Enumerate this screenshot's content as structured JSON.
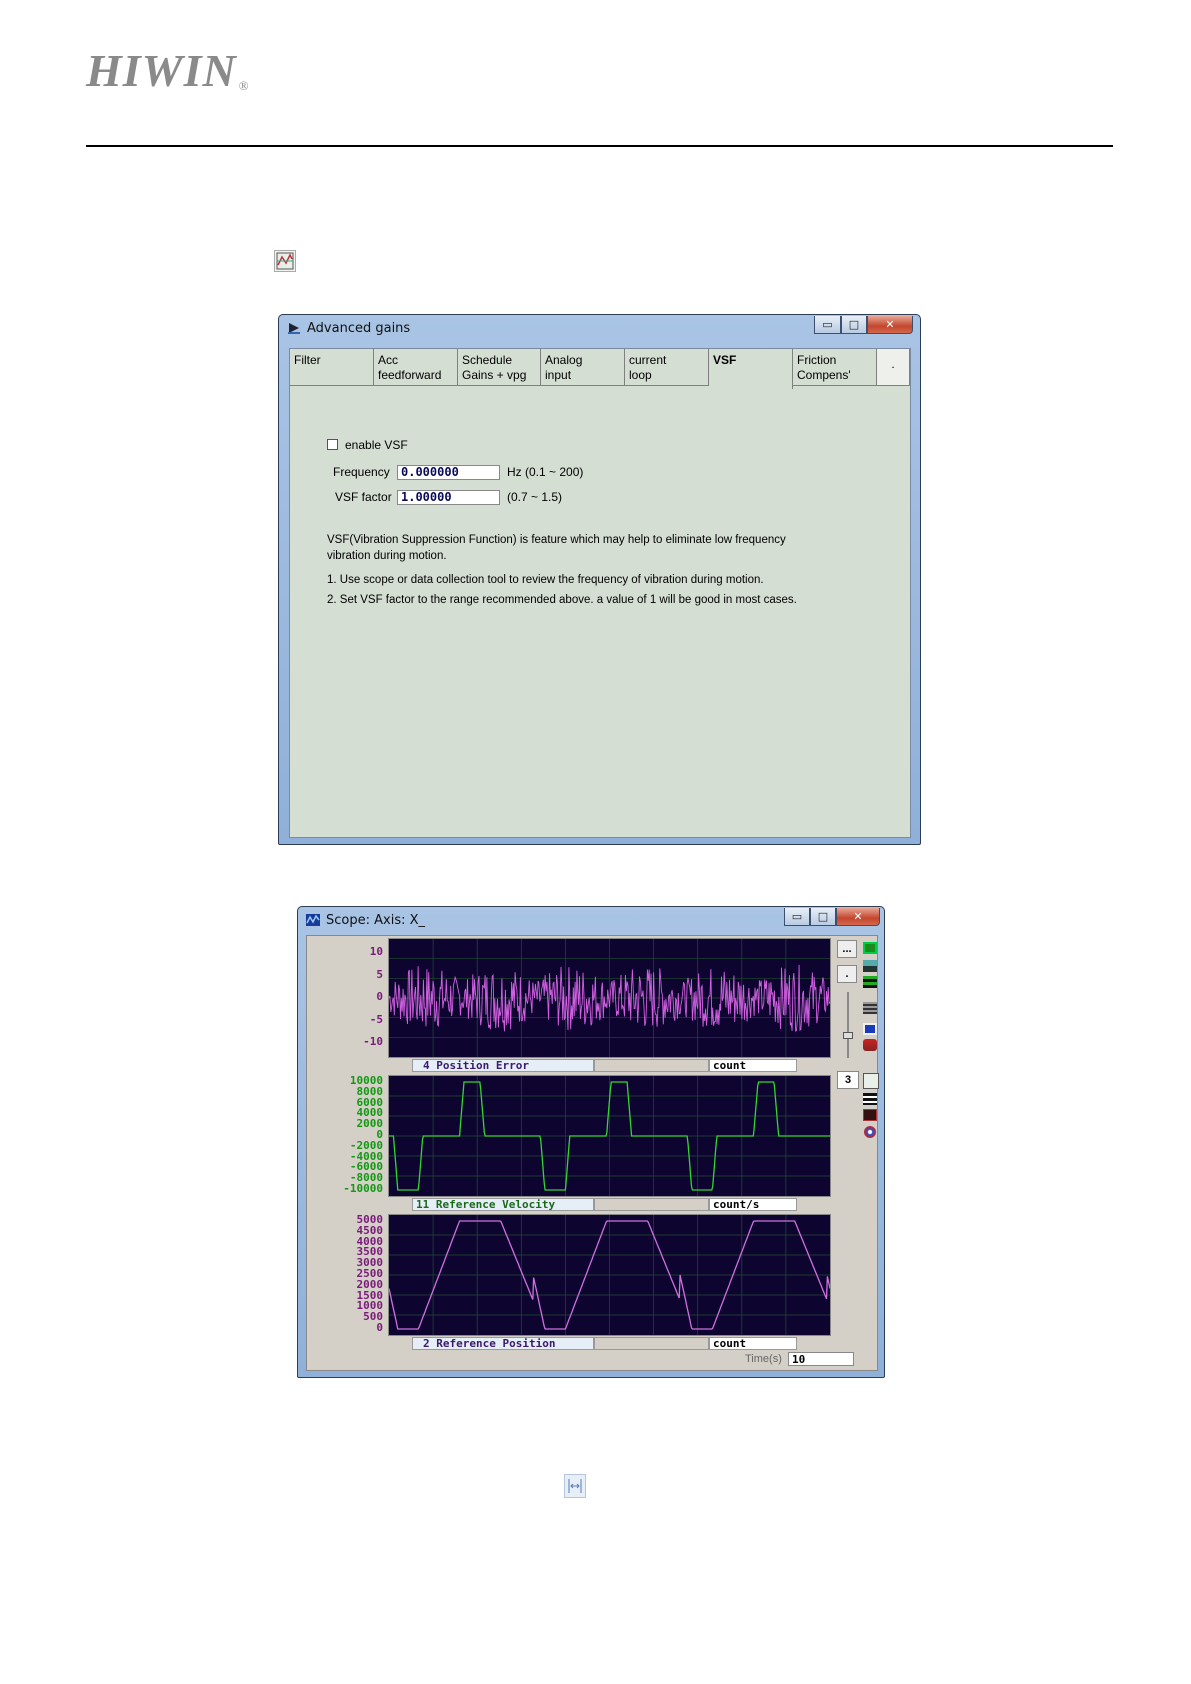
{
  "logo": {
    "name": "HIWIN",
    "mark": "®"
  },
  "advanced_gains": {
    "title": "Advanced gains",
    "caption_buttons": {
      "minimize": "▭",
      "maximize": "□",
      "close": "✕"
    },
    "tabs": [
      {
        "line1": "Filter",
        "line2": ""
      },
      {
        "line1": "Acc",
        "line2": "feedforward"
      },
      {
        "line1": "Schedule",
        "line2": "Gains + vpg"
      },
      {
        "line1": "Analog",
        "line2": "input"
      },
      {
        "line1": "current",
        "line2": "loop"
      },
      {
        "line1": "VSF",
        "line2": ""
      },
      {
        "line1": "Friction",
        "line2": "Compens'"
      }
    ],
    "tab_more": ".",
    "enable_label": "enable VSF",
    "frequency_label": "Frequency",
    "frequency_value": "0.000000",
    "frequency_range": "Hz (0.1 ~ 200)",
    "factor_label": "VSF factor",
    "factor_value": "1.00000",
    "factor_range": "(0.7 ~ 1.5)",
    "desc_line1": "VSF(Vibration Suppression Function) is feature which may help to eliminate low frequency",
    "desc_line2": "vibration during motion.",
    "step1": "1. Use scope or data collection tool to review the frequency of vibration during motion.",
    "step2": "2. Set VSF factor to the range recommended above. a value of 1 will be good in most cases."
  },
  "scope": {
    "title": "Scope: Axis: X_",
    "caption_buttons": {
      "minimize": "▭",
      "maximize": "□",
      "close": "✕"
    },
    "btn_more": "...",
    "btn_dot": ".",
    "channel_count": "3",
    "time_label": "Time(s)",
    "time_value": "10",
    "channels": [
      {
        "name": "4 Position Error",
        "unit": "count",
        "color": "#d060e0",
        "ticks": [
          "10",
          "5",
          "0",
          "-5",
          "-10"
        ],
        "ylim": [
          -12,
          12
        ]
      },
      {
        "name": "11 Reference Velocity",
        "unit": "count/s",
        "color": "#33d633",
        "ticks": [
          "10000",
          "8000",
          "6000",
          "4000",
          "2000",
          "0",
          "-2000",
          "-4000",
          "-6000",
          "-8000",
          "-10000"
        ],
        "ylim": [
          -10000,
          10000
        ]
      },
      {
        "name": "2 Reference Position",
        "unit": "count",
        "color": "#d070e0",
        "ticks": [
          "5000",
          "4500",
          "4000",
          "3500",
          "3000",
          "2500",
          "2000",
          "1500",
          "1000",
          "500",
          "0"
        ],
        "ylim": [
          0,
          5000
        ]
      }
    ],
    "icons": [
      "scope-on-icon",
      "channel-icon",
      "grid-icon",
      "list-icon",
      "blue-bar-icon",
      "trigger-icon",
      "scope-view-icon",
      "bars-icon",
      "chart-icon",
      "target-icon"
    ]
  }
}
